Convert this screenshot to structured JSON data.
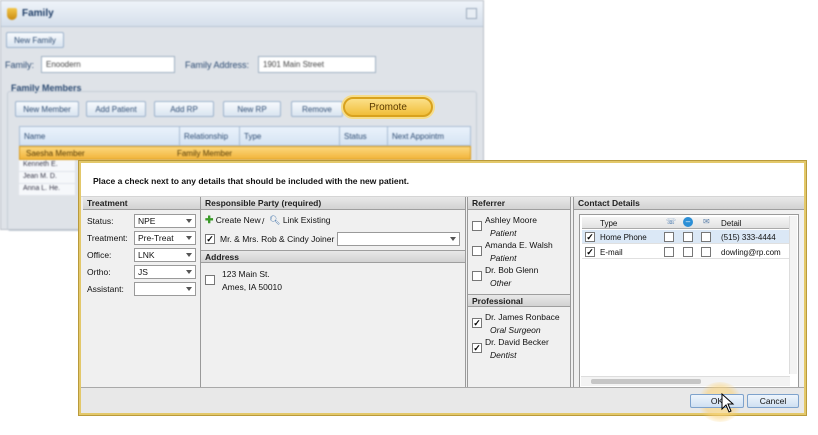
{
  "background_window": {
    "title": "Family",
    "new_family_label": "New Family",
    "family_label": "Family:",
    "family_value": "Enoodern",
    "family_address_label": "Family Address:",
    "family_address_value": "1901 Main Street",
    "members_group_title": "Family Members",
    "buttons": [
      "New Member",
      "Add Patient",
      "Add RP",
      "New RP",
      "Remove"
    ],
    "promote_label": "Promote",
    "table_headers": [
      "Name",
      "Relationship",
      "Type",
      "Status",
      "Next Appointm"
    ],
    "selected_row": {
      "name": "Saesha Member",
      "type": "Family Member"
    },
    "rows": [
      "Kenneth E.",
      "Jean M. D.",
      "Anna L. He."
    ]
  },
  "dialog": {
    "instruction": "Place a check next to any details that should be included with the new patient.",
    "treatment": {
      "title": "Treatment",
      "fields": [
        {
          "label": "Status:",
          "value": "NPE"
        },
        {
          "label": "Treatment:",
          "value": "Pre-Treat"
        },
        {
          "label": "Office:",
          "value": "LNK"
        },
        {
          "label": "Ortho:",
          "value": "JS"
        },
        {
          "label": "Assistant:",
          "value": ""
        }
      ]
    },
    "responsible_party": {
      "title": "Responsible Party (required)",
      "create_new_label": "Create New",
      "separator": "/",
      "link_existing_label": "Link Existing",
      "party_name": "Mr. & Mrs. Rob & Cindy Joiner",
      "party_checked": true,
      "party_select_value": ""
    },
    "address": {
      "title": "Address",
      "line1": "123 Main St.",
      "line2": "Ames, IA 50010",
      "checked": false
    },
    "referrer": {
      "title": "Referrer",
      "items": [
        {
          "name": "Ashley Moore",
          "role": "Patient",
          "checked": false
        },
        {
          "name": "Amanda E. Walsh",
          "role": "Patient",
          "checked": false
        },
        {
          "name": "Dr. Bob Glenn",
          "role": "Other",
          "checked": false
        }
      ]
    },
    "professional": {
      "title": "Professional",
      "items": [
        {
          "name": "Dr. James Ronbace",
          "role": "Oral Surgeon",
          "checked": true
        },
        {
          "name": "Dr. David Becker",
          "role": "Dentist",
          "checked": true
        }
      ]
    },
    "contact_details": {
      "title": "Contact Details",
      "columns": [
        "Type",
        "phone-icon",
        "no-call-icon",
        "email-icon",
        "Detail"
      ],
      "rows": [
        {
          "checked": true,
          "type": "Home Phone",
          "detail": "(515) 333-4444"
        },
        {
          "checked": true,
          "type": "E-mail",
          "detail": "dowling@rp.com"
        }
      ]
    },
    "ok_label": "OK",
    "cancel_label": "Cancel"
  },
  "colors": {
    "highlight": "#f1be3a",
    "dialog_border": "#e3c86a",
    "button_blue": "#cfe0f2"
  }
}
